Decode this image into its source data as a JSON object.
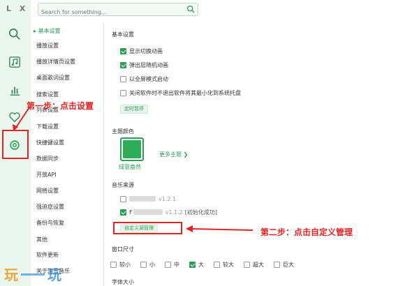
{
  "app": {
    "logo": "L X"
  },
  "search": {
    "placeholder": "Search for something..."
  },
  "rail": [
    "search-icon",
    "music-note-icon",
    "bar-chart-icon",
    "heart-icon",
    "settings-icon"
  ],
  "nav": [
    "基本设置",
    "播放设置",
    "播放详情页设置",
    "桌面歌词设置",
    "搜索设置",
    "列表设置",
    "下载设置",
    "快捷键设置",
    "数据同步",
    "开放API",
    "网络设置",
    "强迫症设置",
    "备份与恢复",
    "其他",
    "软件更新",
    "关于洛雪音乐"
  ],
  "basic": {
    "title": "基本设置",
    "options": [
      {
        "label": "显示切换动画",
        "checked": true
      },
      {
        "label": "弹出层随机动画",
        "checked": true
      },
      {
        "label": "以全屏模式启动",
        "checked": false
      },
      {
        "label": "关闭软件时不退出软件将其最小化到系统托盘",
        "checked": false
      }
    ],
    "pill": "定时暂停"
  },
  "theme": {
    "title": "主题颜色",
    "current": "绿意盎然",
    "more": "更多主题 ❯",
    "color": "#2eac5a"
  },
  "source": {
    "title": "音乐来源",
    "items": [
      {
        "prefix": "",
        "version": "v1.2.1",
        "status": "",
        "checked": false
      },
      {
        "prefix": "F",
        "version": "v1.1.2",
        "status": "[初始化成功]",
        "checked": true
      }
    ],
    "custom_button": "自定义源管理"
  },
  "window_size": {
    "title": "窗口尺寸",
    "options": [
      {
        "label": "较小",
        "checked": false
      },
      {
        "label": "小",
        "checked": false
      },
      {
        "label": "中",
        "checked": false
      },
      {
        "label": "大",
        "checked": true
      },
      {
        "label": "较大",
        "checked": false
      },
      {
        "label": "超大",
        "checked": false
      },
      {
        "label": "巨大",
        "checked": false
      }
    ]
  },
  "font_size": {
    "title": "字体大小"
  },
  "annotations": {
    "step1": "第一步：点击设置",
    "step2": "第二步：点击自定义管理"
  },
  "watermark": {
    "char1": "玩",
    "char2": "玩"
  },
  "colors": {
    "accent": "#2a9d56",
    "annotation": "#e02424",
    "rail_bg": "#eaf5ee"
  }
}
